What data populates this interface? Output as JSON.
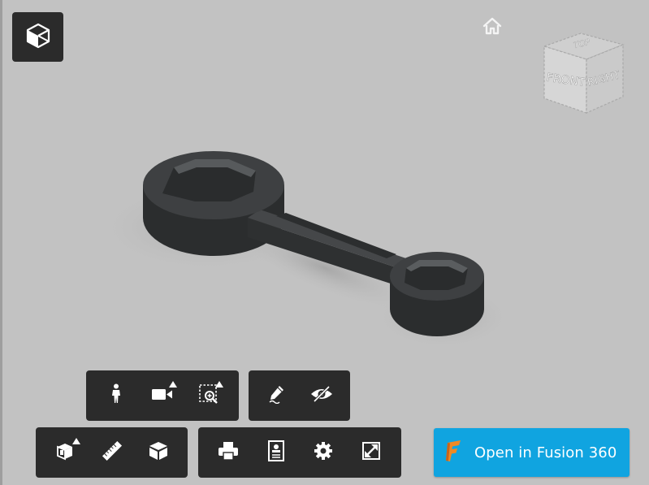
{
  "viewer": {
    "background": "#c2c2c2",
    "model_color": "#2f3133",
    "toolbar_color": "#2b2b2b",
    "accent": "#10a4e0"
  },
  "viewcube": {
    "faces": {
      "top": "TOP",
      "front": "FRONT",
      "right": "RIGHT"
    }
  },
  "icons": {
    "model_browser": "cube-outline-icon",
    "home": "home-icon"
  },
  "toolbars": {
    "navigation": [
      {
        "id": "walk",
        "icon": "person-walk-icon",
        "has_menu": false
      },
      {
        "id": "camera",
        "icon": "video-camera-icon",
        "has_menu": true
      },
      {
        "id": "zoom-window",
        "icon": "zoom-window-icon",
        "has_menu": true
      }
    ],
    "markup": [
      {
        "id": "markup",
        "icon": "pencil-icon",
        "has_menu": false
      },
      {
        "id": "hide",
        "icon": "eye-hidden-icon",
        "has_menu": false
      }
    ],
    "model": [
      {
        "id": "explode",
        "icon": "explode-model-icon",
        "has_menu": true
      },
      {
        "id": "measure",
        "icon": "ruler-icon",
        "has_menu": false
      },
      {
        "id": "model-browser",
        "icon": "cube-icon",
        "has_menu": false
      }
    ],
    "settings": [
      {
        "id": "print",
        "icon": "printer-icon",
        "has_menu": false
      },
      {
        "id": "properties",
        "icon": "properties-icon",
        "has_menu": false
      },
      {
        "id": "settings",
        "icon": "gear-icon",
        "has_menu": false
      },
      {
        "id": "fullscreen",
        "icon": "fullscreen-icon",
        "has_menu": false
      }
    ]
  },
  "fusion_button": {
    "label": "Open in Fusion 360",
    "icon": "fusion-360-logo-icon"
  }
}
